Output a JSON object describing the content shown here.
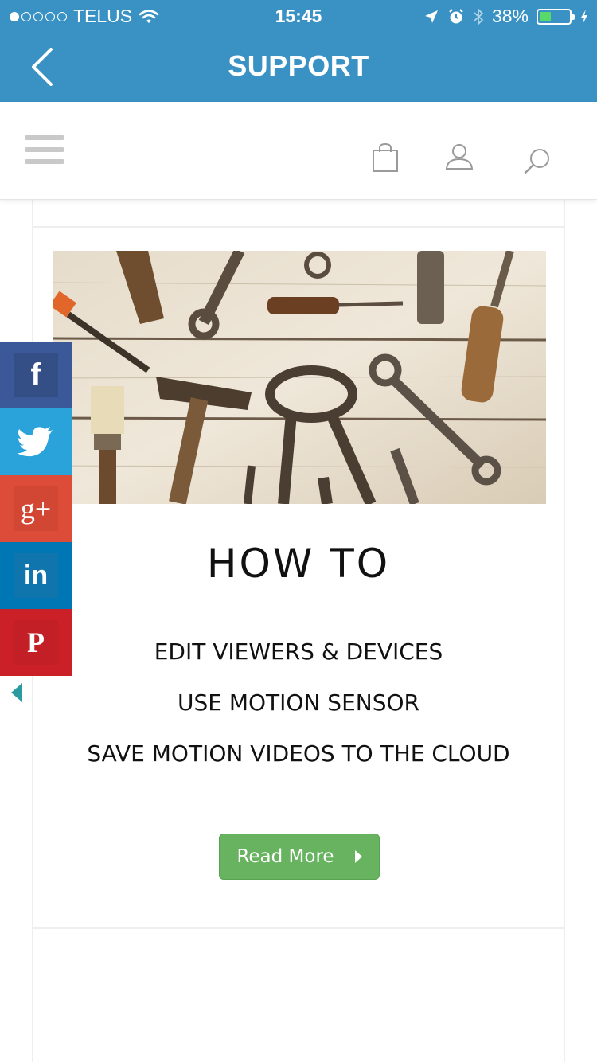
{
  "status_bar": {
    "carrier": "TELUS",
    "time": "15:45",
    "battery_percent": "38%",
    "battery_level": 0.38,
    "signal_bars": 1
  },
  "titlebar": {
    "title": "SUPPORT",
    "back_icon": "chevron-left-icon"
  },
  "header": {
    "menu_icon": "hamburger-icon",
    "icons": [
      "shopping-bag-icon",
      "user-icon",
      "search-icon"
    ]
  },
  "social_share": {
    "items": [
      {
        "name": "facebook",
        "glyph": "f",
        "color": "#3b5998"
      },
      {
        "name": "twitter",
        "glyph": "twitter-bird-icon",
        "color": "#2aa3db"
      },
      {
        "name": "google-plus",
        "glyph": "g+",
        "color": "#dd4b39"
      },
      {
        "name": "linkedin",
        "glyph": "in",
        "color": "#0077b5"
      },
      {
        "name": "pinterest",
        "glyph": "P",
        "color": "#cb2027"
      }
    ],
    "collapse_icon": "triangle-left-icon",
    "collapse_color": "#2a9aa0"
  },
  "article": {
    "image_alt": "tools-image",
    "heading": "HOW TO",
    "links": [
      "EDIT VIEWERS & DEVICES",
      "USE MOTION SENSOR",
      "SAVE MOTION VIDEOS TO THE CLOUD"
    ],
    "read_more_label": "Read More"
  },
  "colors": {
    "titlebar_bg": "#3a92c4",
    "read_more_bg": "#68b360"
  }
}
